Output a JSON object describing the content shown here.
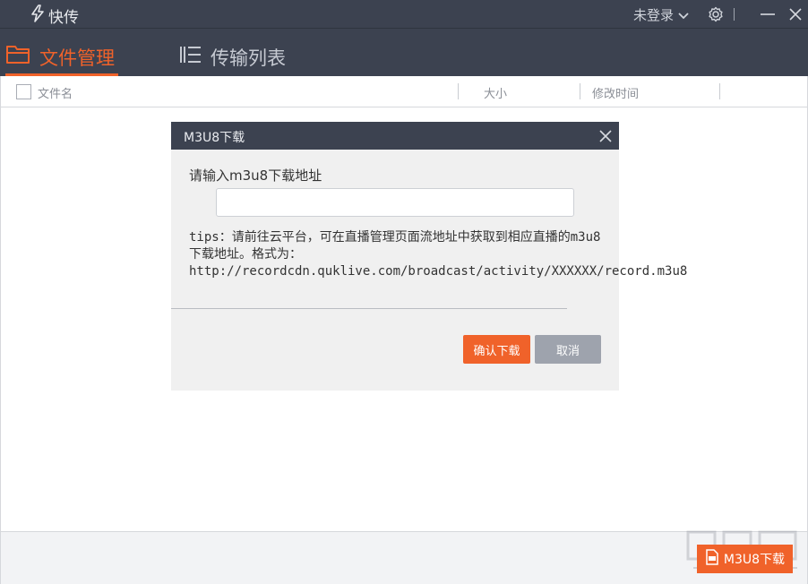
{
  "app": {
    "title": "快传"
  },
  "titlebar": {
    "login_label": "未登录",
    "icons": [
      "lightning-logo-icon",
      "chevron-down-icon",
      "gear-icon",
      "minimize-icon",
      "close-icon"
    ]
  },
  "tabs": [
    {
      "label": "文件管理",
      "icon": "folder-icon",
      "active": true
    },
    {
      "label": "传输列表",
      "icon": "transfer-list-icon",
      "active": false
    }
  ],
  "table": {
    "columns": [
      "文件名",
      "大小",
      "修改时间"
    ]
  },
  "dialog": {
    "title": "M3U8下载",
    "label": "请输入m3u8下载地址",
    "input_value": "",
    "input_placeholder": "",
    "tips": "tips：请前往云平台，可在直播管理页面流地址中获取到相应直播的m3u8下载地址。格式为：http://recordcdn.quklive.com/broadcast/activity/XXXXXX/record.m3u8",
    "confirm_label": "确认下载",
    "cancel_label": "取消"
  },
  "bottombar": {
    "m3u8_button_label": "M3U8下载"
  },
  "colors": {
    "accent": "#f0622a",
    "titlebar_bg": "#3c4250",
    "dialog_bg": "#f0f0f0",
    "cancel_bg": "#9ea3ad"
  }
}
